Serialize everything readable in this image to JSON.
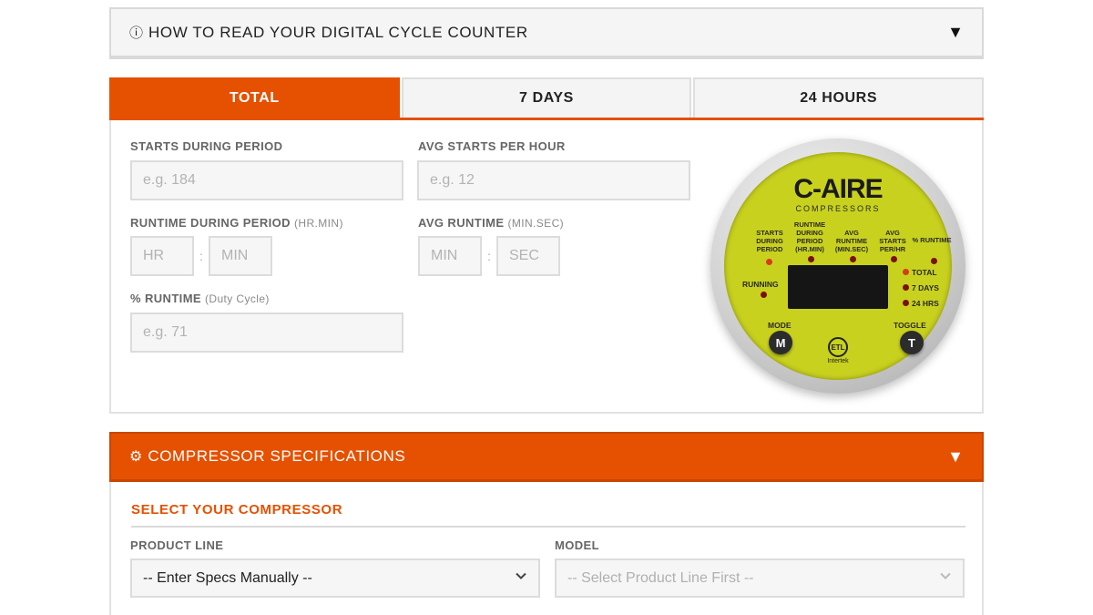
{
  "howto": {
    "title": "HOW TO READ YOUR DIGITAL CYCLE COUNTER",
    "info_glyph": "ⓘ",
    "caret": "▼"
  },
  "tabs": [
    {
      "label": "TOTAL",
      "active": true
    },
    {
      "label": "7 DAYS",
      "active": false
    },
    {
      "label": "24 HOURS",
      "active": false
    }
  ],
  "fields": {
    "starts": {
      "label": "STARTS DURING PERIOD",
      "placeholder": "e.g. 184"
    },
    "avg_starts": {
      "label": "AVG STARTS PER HOUR",
      "placeholder": "e.g. 12"
    },
    "runtime": {
      "label": "RUNTIME DURING PERIOD",
      "sub": "(HR.MIN)",
      "hr_placeholder": "HR",
      "min_placeholder": "MIN"
    },
    "avg_runtime": {
      "label": "AVG RUNTIME",
      "sub": "(MIN.SEC)",
      "min_placeholder": "MIN",
      "sec_placeholder": "SEC"
    },
    "pct_runtime": {
      "label": "% RUNTIME",
      "sub": "(Duty Cycle)",
      "placeholder": "e.g. 71"
    },
    "colon": ":"
  },
  "gauge": {
    "brand": "C-AIRE",
    "brand_sub": "COMPRESSORS",
    "labels": {
      "starts": "STARTS DURING PERIOD",
      "runtime": "RUNTIME DURING PERIOD (HR.MIN)",
      "avg_runtime": "AVG RUNTIME (MIN.SEC)",
      "avg_starts": "AVG STARTS PER/HR",
      "pct": "% RUNTIME"
    },
    "running": "RUNNING",
    "total": "TOTAL",
    "seven_days": "7 DAYS",
    "hrs24": "24 HRS",
    "mode": "MODE",
    "mode_key": "M",
    "toggle": "TOGGLE",
    "toggle_key": "T",
    "cert_mark": "ETL",
    "cert_text": "Intertek",
    "face_color": "#c8d11e"
  },
  "specs": {
    "title": "COMPRESSOR SPECIFICATIONS",
    "gear_glyph": "⚙",
    "caret": "▼",
    "select_title": "SELECT YOUR COMPRESSOR",
    "product_line_label": "PRODUCT LINE",
    "product_line_value": "-- Enter Specs Manually --",
    "model_label": "MODEL",
    "model_value": "-- Select Product Line First --"
  },
  "colors": {
    "accent": "#e55100"
  }
}
